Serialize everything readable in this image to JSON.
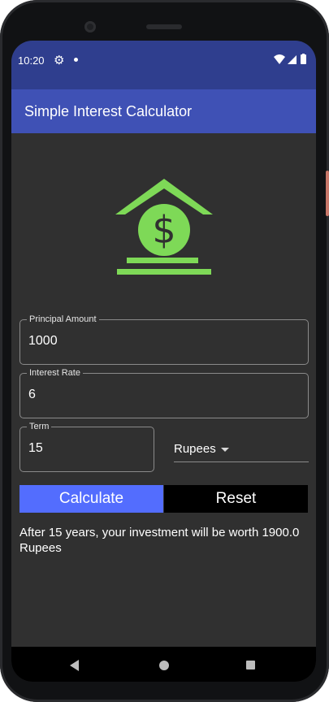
{
  "status_bar": {
    "time": "10:20",
    "icons": [
      "gear-icon",
      "notification-dot-icon",
      "wifi-icon",
      "signal-icon",
      "battery-icon"
    ]
  },
  "app_bar": {
    "title": "Simple Interest Calculator"
  },
  "logo": {
    "icon": "money-house-icon",
    "symbol": "$",
    "color": "#7ed957"
  },
  "form": {
    "principal": {
      "label": "Principal Amount",
      "value": "1000"
    },
    "rate": {
      "label": "Interest Rate",
      "value": "6"
    },
    "term": {
      "label": "Term",
      "value": "15"
    },
    "currency": {
      "selected": "Rupees"
    }
  },
  "buttons": {
    "calculate": "Calculate",
    "reset": "Reset"
  },
  "result": {
    "text": "After 15 years, your investment will be worth 1900.0 Rupees"
  },
  "nav_bar": {
    "icons": [
      "back-icon",
      "home-icon",
      "recents-icon"
    ]
  },
  "colors": {
    "status_bar": "#2f3e8e",
    "app_bar": "#3f51b5",
    "background": "#303030",
    "calculate_button": "#536dfe",
    "reset_button": "#000000",
    "logo": "#7ed957"
  }
}
